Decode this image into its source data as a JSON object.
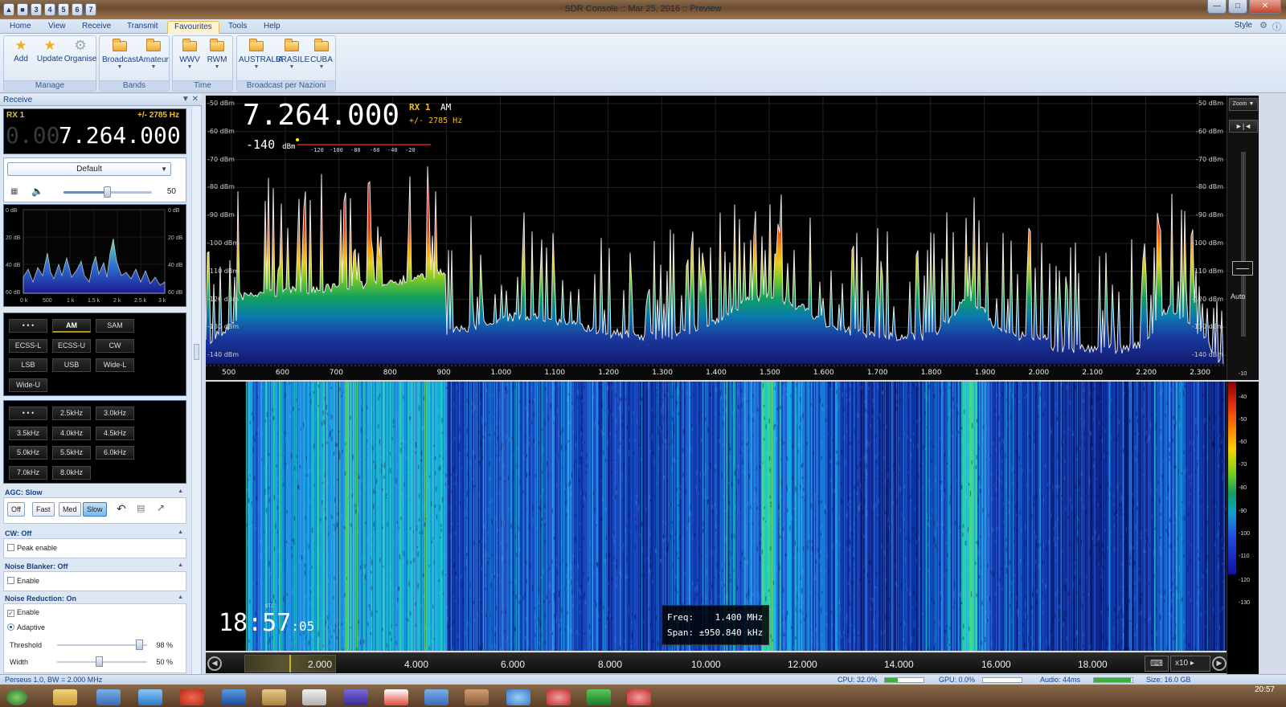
{
  "window": {
    "title": "SDR Console :: Mar 25, 2016 :: Preview",
    "quick_access": [
      "3",
      "4",
      "5",
      "6",
      "7"
    ]
  },
  "ribbon": {
    "tabs": [
      "Home",
      "View",
      "Receive",
      "Transmit",
      "Favourites",
      "Tools",
      "Help"
    ],
    "active_tab": "Favourites",
    "style_label": "Style",
    "groups": {
      "manage": {
        "label": "Manage",
        "items": [
          "Add",
          "Update",
          "Organise"
        ]
      },
      "bands": {
        "label": "Bands",
        "items": [
          "Broadcast",
          "Amateur"
        ]
      },
      "time": {
        "label": "Time",
        "items": [
          "WWV",
          "RWM"
        ]
      },
      "nations": {
        "label": "Broadcast per Nazioni",
        "items": [
          "AUSTRALIA",
          "BRASILE",
          "CUBA"
        ]
      }
    }
  },
  "receive_panel": {
    "header": "Receive",
    "rx_label": "RX 1",
    "bandwidth": "+/- 2785 Hz",
    "freq_dim": "0.00",
    "freq_main": "7.264.000",
    "profile": "Default",
    "volume": "50",
    "volume_level": 0.5,
    "audio_scope": {
      "db_left": [
        "0 dB",
        "20 dB",
        "40 dB",
        "60 dB"
      ],
      "db_right": [
        "0 dB",
        "20 dB",
        "40 dB",
        "60 dB"
      ],
      "x_labels": [
        "0 k",
        "500",
        "1 k",
        "1.5 k",
        "2 k",
        "2.5 k",
        "3 k"
      ]
    },
    "modes": [
      "• • •",
      "AM",
      "SAM",
      "ECSS-L",
      "ECSS-U",
      "CW",
      "LSB",
      "USB",
      "Wide-L",
      "Wide-U"
    ],
    "active_mode": "AM",
    "filters": [
      "• • •",
      "2.5kHz",
      "3.0kHz",
      "3.5kHz",
      "4.0kHz",
      "4.5kHz",
      "5.0kHz",
      "5.5kHz",
      "6.0kHz",
      "7.0kHz",
      "8.0kHz"
    ],
    "agc": {
      "title": "AGC: Slow",
      "buttons": [
        "Off",
        "Fast",
        "Med",
        "Slow"
      ],
      "active": "Slow"
    },
    "cw": {
      "title": "CW: Off",
      "peak_label": "Peak enable"
    },
    "noise_blanker": {
      "title": "Noise Blanker: Off",
      "enable_label": "Enable"
    },
    "noise_reduction": {
      "title": "Noise Reduction: On",
      "enable_label": "Enable",
      "adaptive_label": "Adaptive",
      "threshold_label": "Threshold",
      "threshold_value": "98 %",
      "width_label": "Width",
      "width_value": "50 %"
    }
  },
  "spectrum": {
    "frequency": "7.264.000",
    "rx_label": "RX 1",
    "mode": "AM",
    "bandwidth": "+/- 2785 Hz",
    "signal_dbm": "-140",
    "signal_unit": "dBm",
    "smeter_ticks": [
      "-120",
      "-100",
      "-80",
      "-60",
      "-40",
      "-20"
    ],
    "db_labels": [
      "-50 dBm",
      "-60 dBm",
      "-70 dBm",
      "-80 dBm",
      "-90 dBm",
      "-100 dBm",
      "-110 dBm",
      "-120 dBm",
      "-130 dBm",
      "-140 dBm"
    ],
    "freq_labels": [
      "500",
      "600",
      "700",
      "800",
      "900",
      "1.000",
      "1.100",
      "1.200",
      "1.300",
      "1.400",
      "1.500",
      "1.600",
      "1.700",
      "1.800",
      "1.900",
      "2.000",
      "2.100",
      "2.200",
      "2.300"
    ],
    "zoom_label": "Zoom ▼",
    "auto_label": "Auto"
  },
  "waterfall": {
    "clock_main": "18:57",
    "clock_sec": ":05",
    "utc_label": "UTC",
    "info_text": "Freq:    1.400 MHz\nSpan: ±950.840 kHz",
    "scale_labels": [
      "-10",
      "-40",
      "-50",
      "-60",
      "-70",
      "-80",
      "-90",
      "-100",
      "-110",
      "-120",
      "-130"
    ],
    "bottom_labels": [
      "2.000",
      "4.000",
      "6.000",
      "8.000",
      "10.000",
      "12.000",
      "14.000",
      "16.000",
      "18.000"
    ],
    "zoom_factor": "x10"
  },
  "status_bar": {
    "device": "Perseus 1.0, BW = 2.000 MHz",
    "cpu": "CPU: 32.0%",
    "gpu": "GPU: 0.0%",
    "audio": "Audio: 44ms",
    "size": "Size: 16.0 GB"
  },
  "taskbar": {
    "time": "20:57"
  }
}
